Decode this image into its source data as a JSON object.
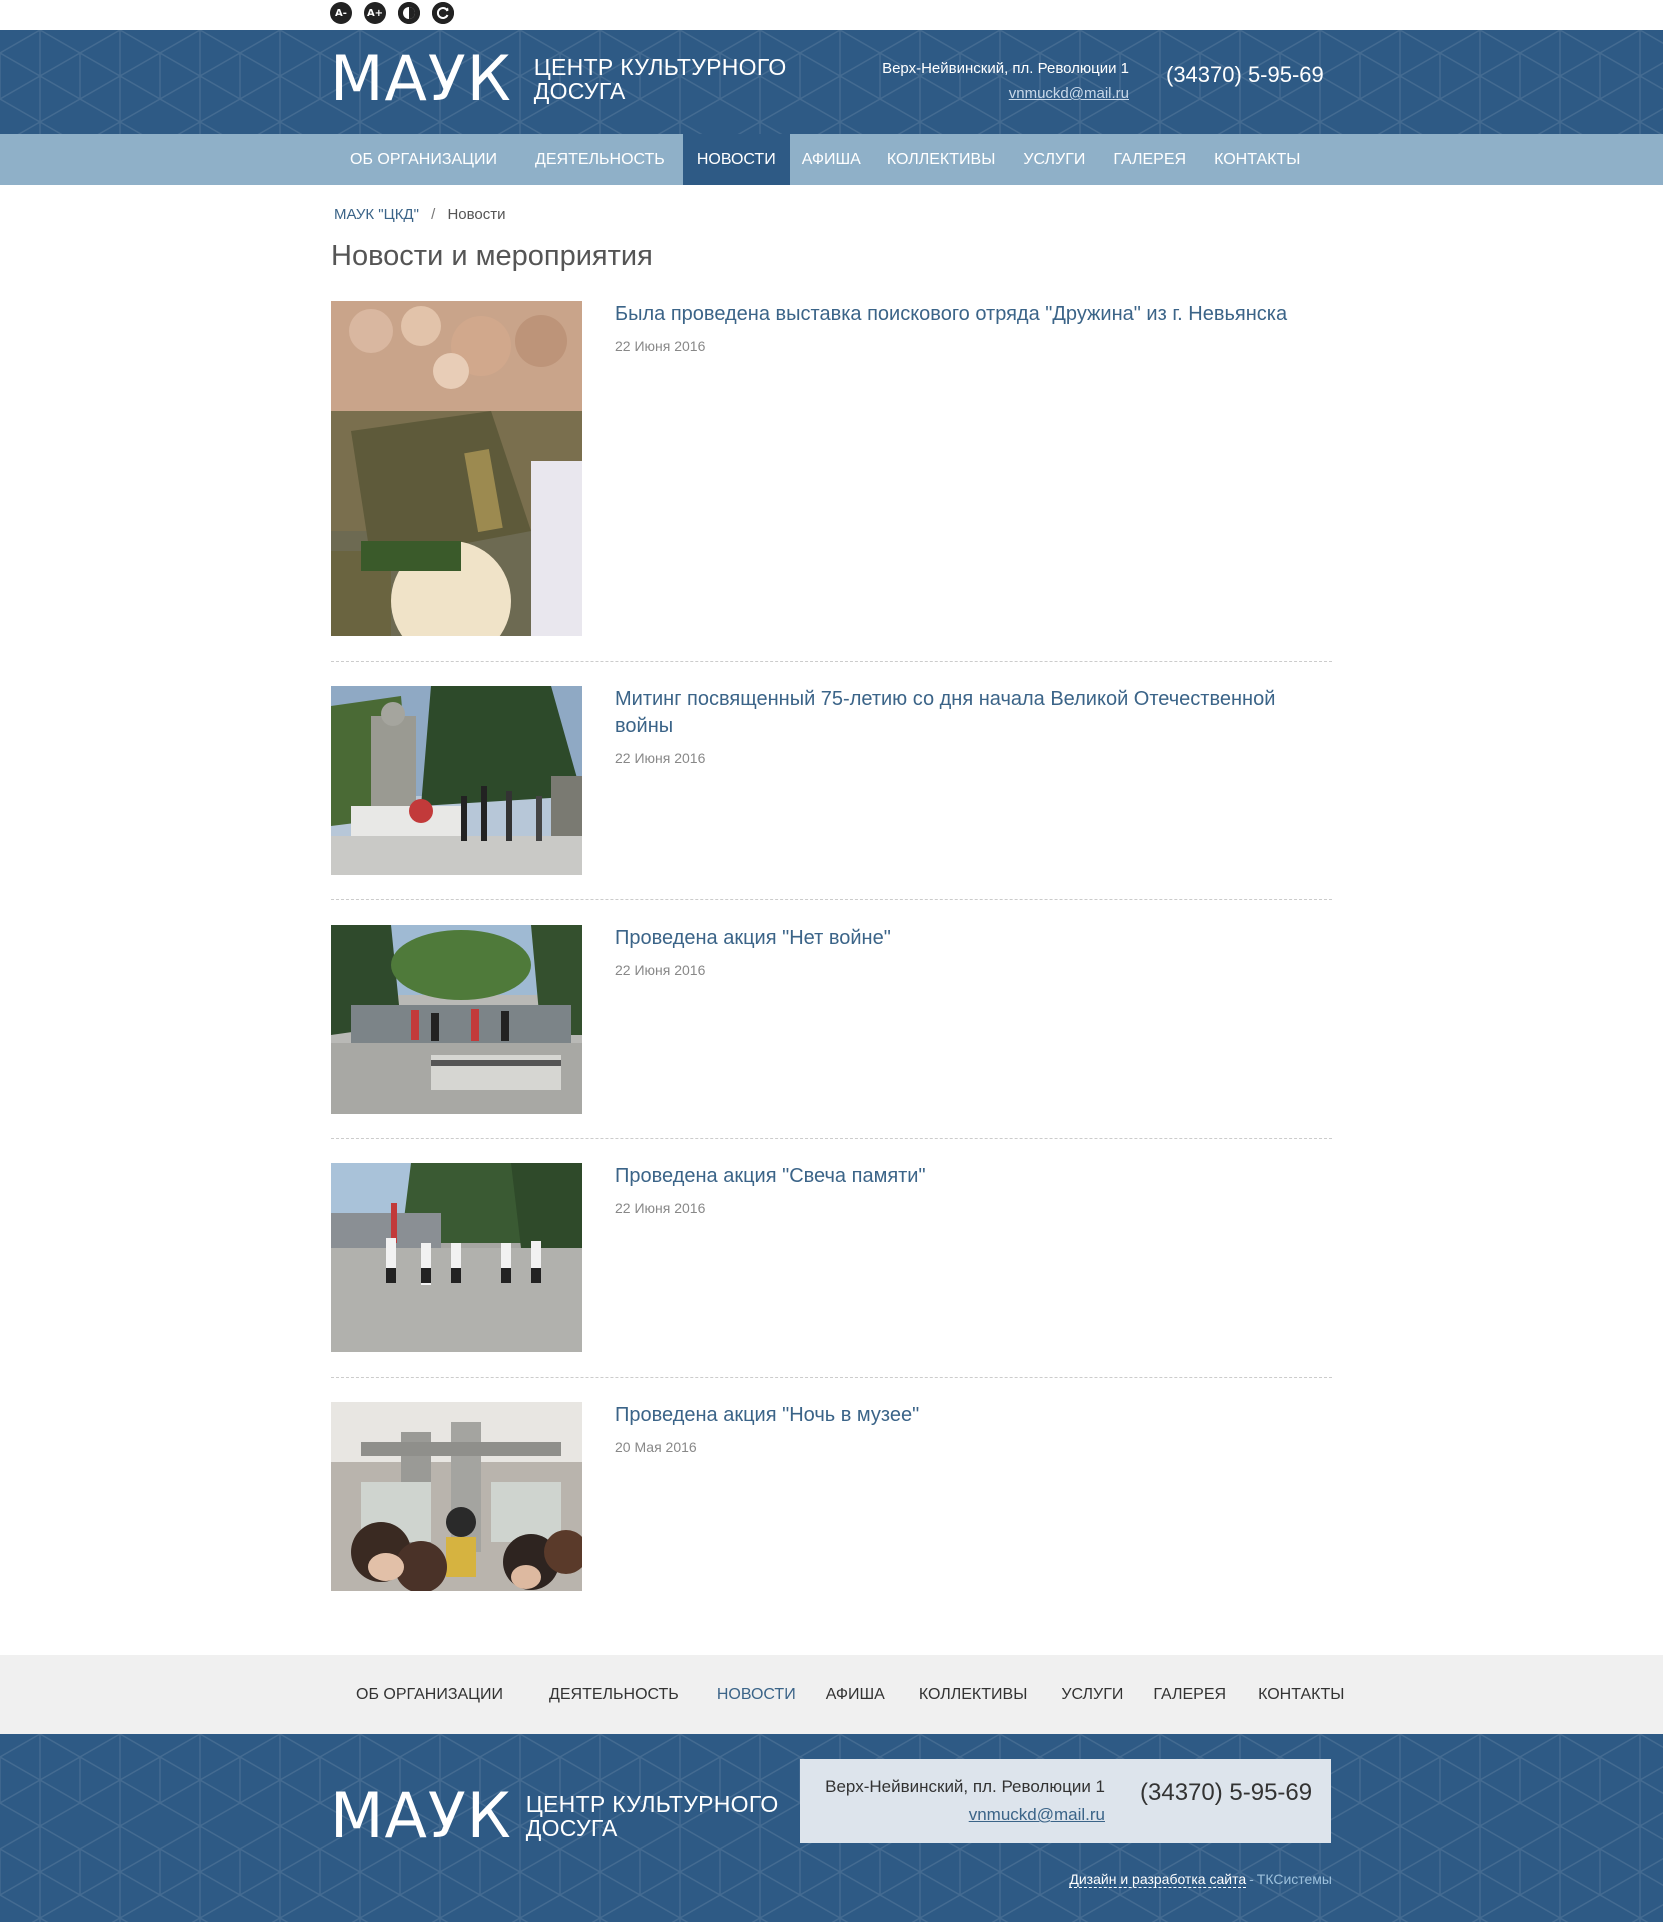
{
  "accessibility": {
    "font_decrease": "A-",
    "font_increase": "A+",
    "contrast_icon": "contrast-icon",
    "reset_icon": "reset-icon"
  },
  "header": {
    "logo_main": "МАУК",
    "logo_sub_line1": "ЦЕНТР КУЛЬТУРНОГО",
    "logo_sub_line2": "ДОСУГА",
    "address": "Верх-Нейвинский, пл. Революции 1",
    "email": "vnmuckd@mail.ru",
    "phone": "(34370) 5-95-69"
  },
  "nav": [
    {
      "label": "ОБ ОРГАНИЗАЦИИ",
      "active": false
    },
    {
      "label": "ДЕЯТЕЛЬНОСТЬ",
      "active": false
    },
    {
      "label": "НОВОСТИ",
      "active": true
    },
    {
      "label": "АФИША",
      "active": false
    },
    {
      "label": "КОЛЛЕКТИВЫ",
      "active": false
    },
    {
      "label": "УСЛУГИ",
      "active": false
    },
    {
      "label": "ГАЛЕРЕЯ",
      "active": false
    },
    {
      "label": "КОНТАКТЫ",
      "active": false
    }
  ],
  "breadcrumb": {
    "home": "МАУК \"ЦКД\"",
    "separator": "/",
    "current": "Новости"
  },
  "page_title": "Новости и мероприятия",
  "news": [
    {
      "title": "Была проведена выставка поискового отряда \"Дружина\" из г. Невьянска",
      "date": "22 Июня 2016"
    },
    {
      "title": "Митинг посвященный 75-летию со дня начала Великой Отечественной войны",
      "date": "22 Июня 2016"
    },
    {
      "title": "Проведена акция \"Нет войне\"",
      "date": "22 Июня 2016"
    },
    {
      "title": "Проведена акция \"Свеча памяти\"",
      "date": "22 Июня 2016"
    },
    {
      "title": "Проведена акция \"Ночь в музее\"",
      "date": "20 Мая 2016"
    }
  ],
  "footer_nav": [
    {
      "label": "ОБ ОРГАНИЗАЦИИ",
      "active": false
    },
    {
      "label": "ДЕЯТЕЛЬНОСТЬ",
      "active": false
    },
    {
      "label": "НОВОСТИ",
      "active": true
    },
    {
      "label": "АФИША",
      "active": false
    },
    {
      "label": "КОЛЛЕКТИВЫ",
      "active": false
    },
    {
      "label": "УСЛУГИ",
      "active": false
    },
    {
      "label": "ГАЛЕРЕЯ",
      "active": false
    },
    {
      "label": "КОНТАКТЫ",
      "active": false
    }
  ],
  "footer": {
    "logo_main": "МАУК",
    "logo_sub_line1": "ЦЕНТР КУЛЬТУРНОГО",
    "logo_sub_line2": "ДОСУГА",
    "address": "Верх-Нейвинский, пл. Революции 1",
    "email": "vnmuckd@mail.ru",
    "phone": "(34370) 5-95-69",
    "credits_design": "Дизайн и разработка сайта",
    "credits_separator": "-",
    "credits_company": "ТКСистемы"
  },
  "colors": {
    "brand_dark": "#2e5a85",
    "nav_bar": "#8fb0c8",
    "link": "#3b6488"
  }
}
